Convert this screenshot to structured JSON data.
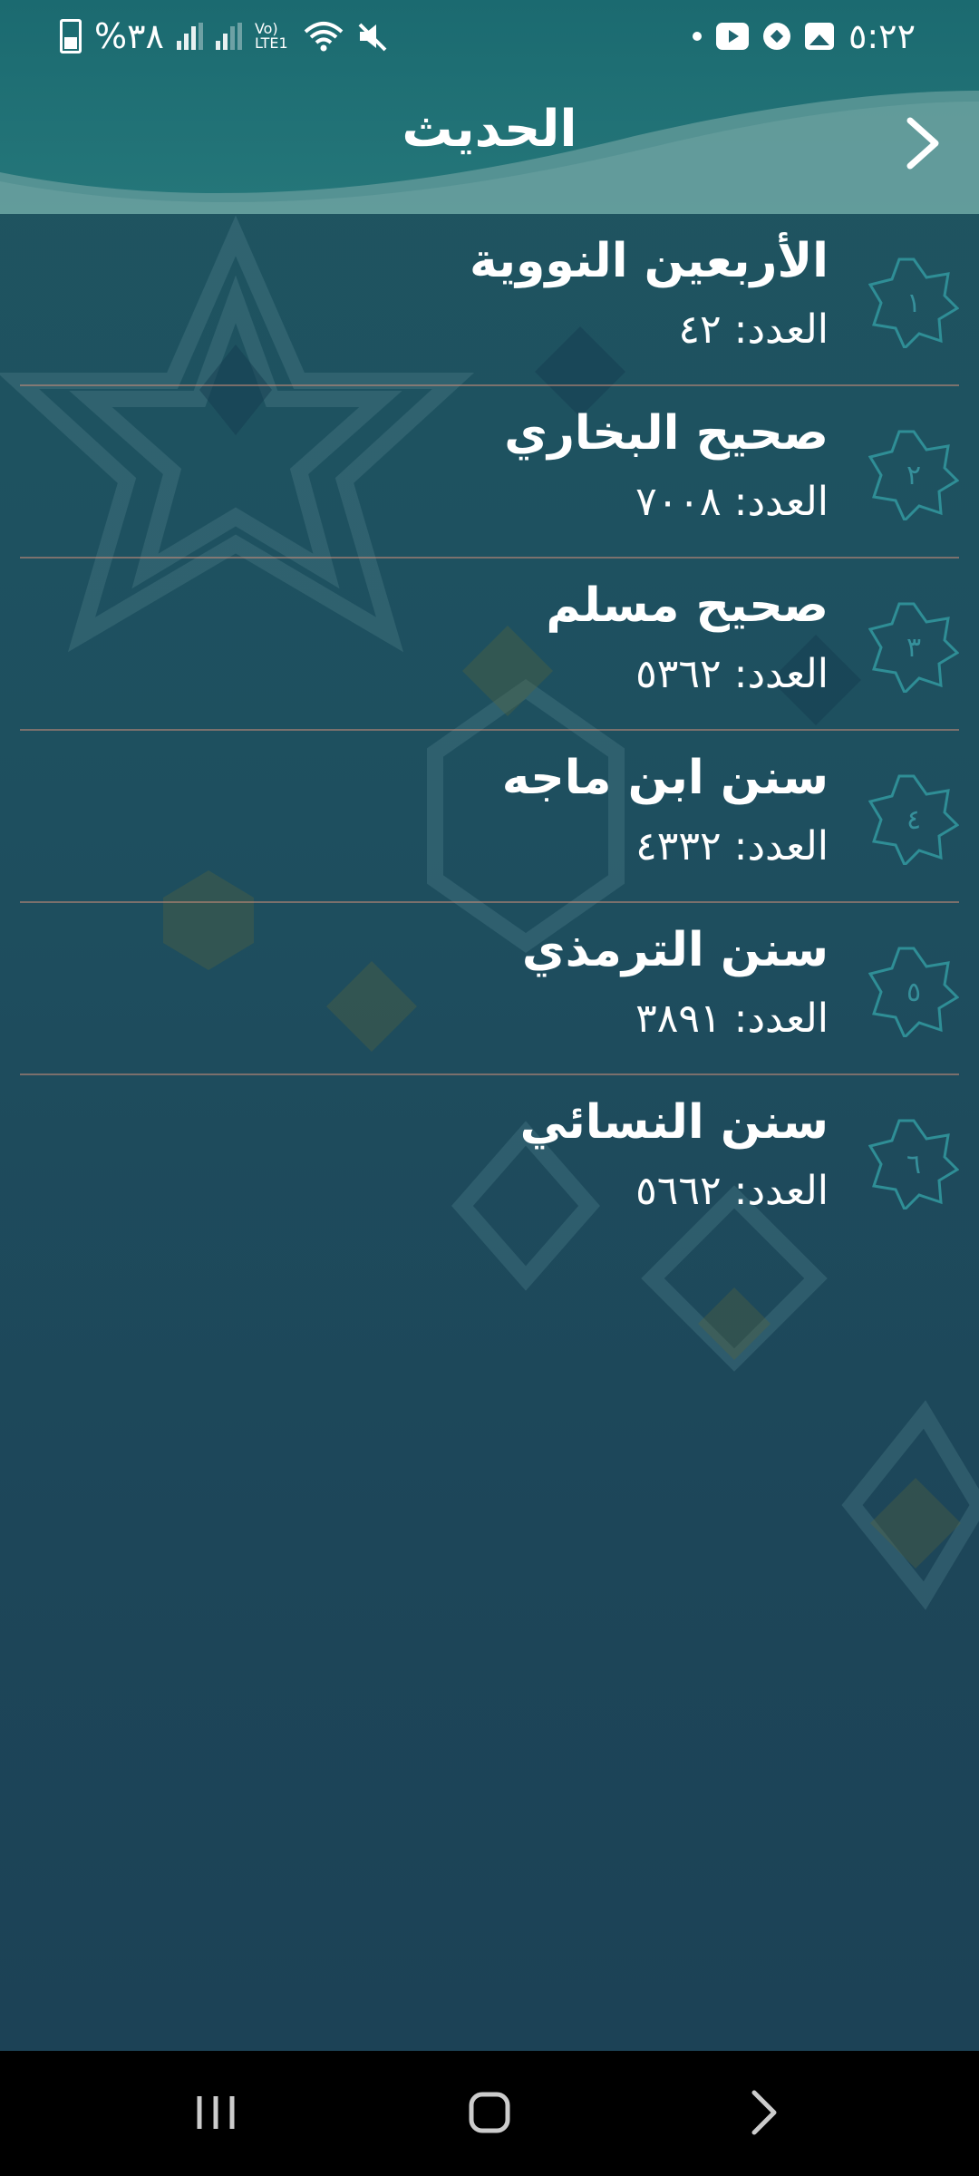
{
  "status_bar": {
    "time": "٥:٢٢",
    "battery_percent": "%٣٨",
    "network": "Vo) LTE1"
  },
  "header": {
    "title": "الحديث"
  },
  "books": [
    {
      "index": "١",
      "title": "الأربعين النووية",
      "count_label": "العدد: ٤٢"
    },
    {
      "index": "٢",
      "title": "صحيح البخاري",
      "count_label": "العدد: ٧٠٠٨"
    },
    {
      "index": "٣",
      "title": "صحيح مسلم",
      "count_label": "العدد: ٥٣٦٢"
    },
    {
      "index": "٤",
      "title": "سنن ابن ماجه",
      "count_label": "العدد: ٤٣٣٢"
    },
    {
      "index": "٥",
      "title": "سنن الترمذي",
      "count_label": "العدد: ٣٨٩١"
    },
    {
      "index": "٦",
      "title": "سنن النسائي",
      "count_label": "العدد: ٥٦٦٢"
    }
  ],
  "colors": {
    "header": "#1b6a70",
    "background": "#1d4a5a",
    "divider": "#c88c78",
    "badge": "#3ca0aa"
  }
}
